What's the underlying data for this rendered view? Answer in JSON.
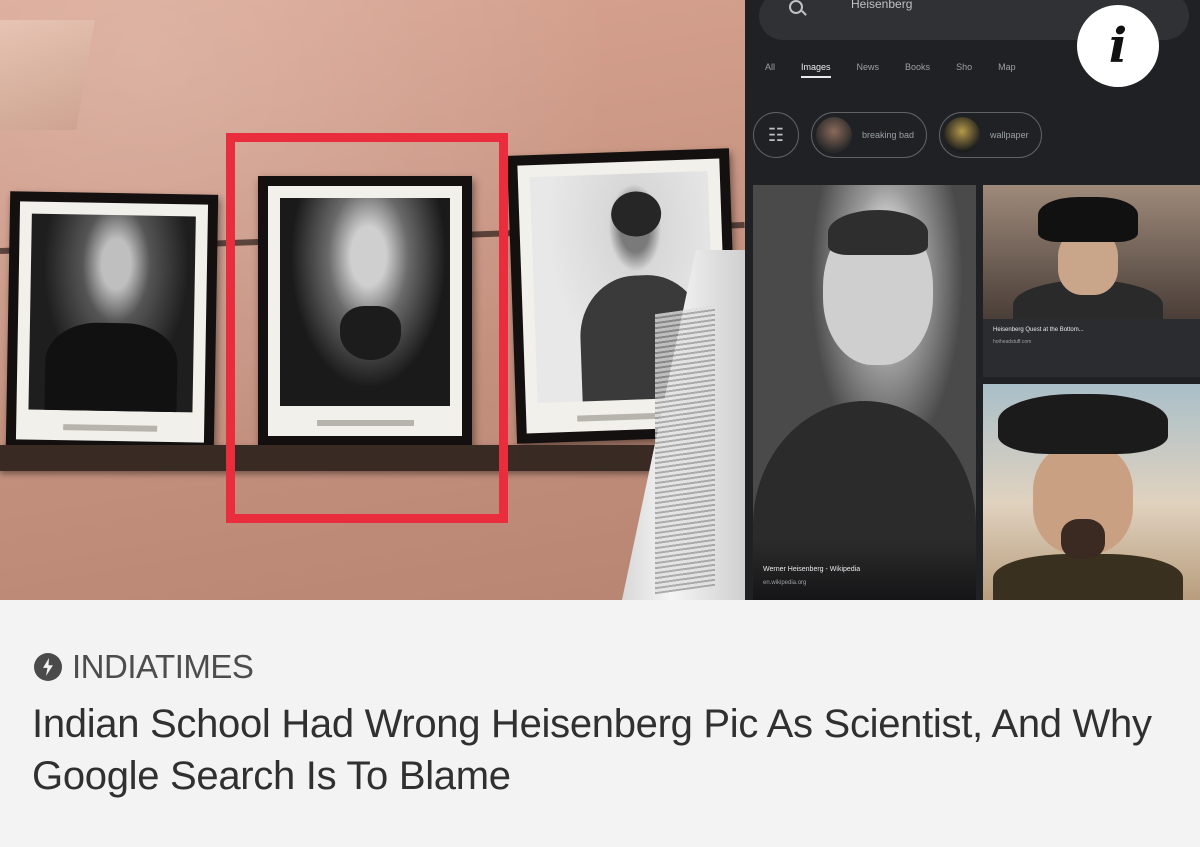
{
  "phone_search": {
    "query": "Heisenberg",
    "tabs": [
      "All",
      "Images",
      "News",
      "Books",
      "Sho",
      "Map"
    ],
    "chips": [
      "breaking bad",
      "wallpaper"
    ]
  },
  "info_button": {
    "glyph": "i"
  },
  "results": {
    "main_caption": "Werner Heisenberg - Wikipedia",
    "main_source": "en.wikipedia.org",
    "side_caption": "Heisenberg Quest at the Bottom...",
    "side_source": "hotheadstuff.com"
  },
  "article": {
    "source": "INDIATIMES",
    "headline": "Indian School Had Wrong Heisenberg Pic As Scientist, And Why Google Search Is To Blame"
  },
  "colors": {
    "highlight": "#ea2d3c",
    "phone_bg": "#202124",
    "card_bg": "#f3f3f4"
  }
}
